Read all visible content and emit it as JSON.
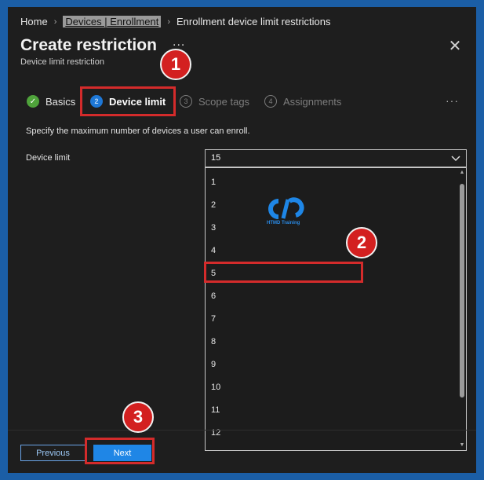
{
  "breadcrumb": {
    "home": "Home",
    "enrollment": "Devices | Enrollment",
    "current": "Enrollment device limit restrictions"
  },
  "header": {
    "title": "Create restriction",
    "more_label": "...",
    "subtitle": "Device limit restriction"
  },
  "tabs": [
    {
      "label": "Basics",
      "step": "✓",
      "state": "complete"
    },
    {
      "label": "Device limit",
      "step": "2",
      "state": "active"
    },
    {
      "label": "Scope tags",
      "step": "3",
      "state": "disabled"
    },
    {
      "label": "Assignments",
      "step": "4",
      "state": "disabled"
    }
  ],
  "tabs_more": "···",
  "form": {
    "description": "Specify the maximum number of devices a user can enroll.",
    "device_limit_label": "Device limit",
    "device_limit_value": "15",
    "options": [
      "1",
      "2",
      "3",
      "4",
      "5",
      "6",
      "7",
      "8",
      "9",
      "10",
      "11",
      "12"
    ]
  },
  "annotations": {
    "badge1": "1",
    "badge2": "2",
    "badge3": "3"
  },
  "watermark": {
    "text": "HTMD Training"
  },
  "footer": {
    "previous_label": "Previous",
    "next_label": "Next"
  },
  "icons": {
    "close": "close-icon",
    "chevron": "chevron-down-icon",
    "check": "checkmark-icon"
  },
  "colors": {
    "accent": "#1f86e6",
    "highlight": "#d42b2b",
    "success": "#4fa33b",
    "frame": "#1b5ea6"
  }
}
